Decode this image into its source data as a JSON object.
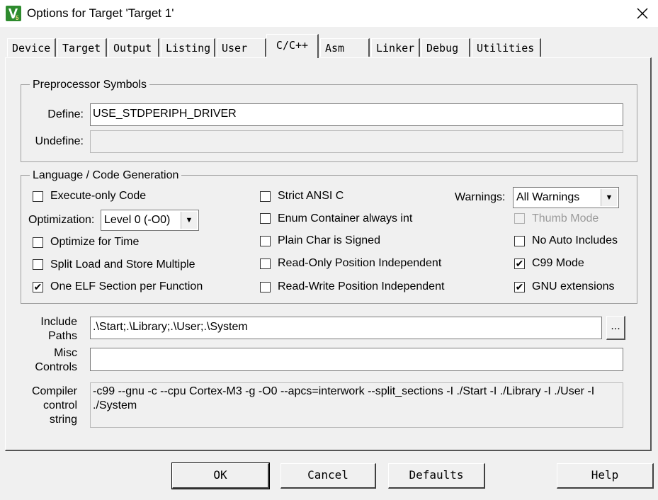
{
  "window": {
    "title": "Options for Target 'Target 1'"
  },
  "tabs": [
    {
      "label": "Device"
    },
    {
      "label": "Target"
    },
    {
      "label": "Output"
    },
    {
      "label": "Listing"
    },
    {
      "label": "User"
    },
    {
      "label": "C/C++"
    },
    {
      "label": "Asm"
    },
    {
      "label": "Linker"
    },
    {
      "label": "Debug"
    },
    {
      "label": "Utilities"
    }
  ],
  "active_tab": "C/C++",
  "preprocessor": {
    "group_label": "Preprocessor Symbols",
    "define_label": "Define:",
    "define_value": "USE_STDPERIPH_DRIVER",
    "undefine_label": "Undefine:",
    "undefine_value": ""
  },
  "codegen": {
    "group_label": "Language / Code Generation",
    "execute_only": {
      "label": "Execute-only Code",
      "checked": false
    },
    "optimization_label": "Optimization:",
    "optimization_value": "Level 0 (-O0)",
    "optimize_time": {
      "label": "Optimize for Time",
      "checked": false
    },
    "split_load": {
      "label": "Split Load and Store Multiple",
      "checked": false
    },
    "one_elf": {
      "label": "One ELF Section per Function",
      "checked": true
    },
    "strict_ansi": {
      "label": "Strict ANSI C",
      "checked": false
    },
    "enum_container": {
      "label": "Enum Container always int",
      "checked": false
    },
    "plain_char": {
      "label": "Plain Char is Signed",
      "checked": false
    },
    "ro_pi": {
      "label": "Read-Only Position Independent",
      "checked": false
    },
    "rw_pi": {
      "label": "Read-Write Position Independent",
      "checked": false
    },
    "warnings_label": "Warnings:",
    "warnings_value": "All Warnings",
    "thumb_mode": {
      "label": "Thumb Mode",
      "checked": false,
      "disabled": true
    },
    "no_auto_includes": {
      "label": "No Auto Includes",
      "checked": false
    },
    "c99_mode": {
      "label": "C99 Mode",
      "checked": true
    },
    "gnu_ext": {
      "label": "GNU extensions",
      "checked": true
    }
  },
  "include_paths": {
    "label_line1": "Include",
    "label_line2": "Paths",
    "value": ".\\Start;.\\Library;.\\User;.\\System",
    "browse_label": "..."
  },
  "misc_controls": {
    "label_line1": "Misc",
    "label_line2": "Controls",
    "value": ""
  },
  "compiler_string": {
    "label_line1": "Compiler",
    "label_line2": "control",
    "label_line3": "string",
    "value": "-c99 --gnu -c --cpu Cortex-M3 -g -O0 --apcs=interwork --split_sections -I ./Start -I ./Library -I ./User -I ./System"
  },
  "buttons": {
    "ok": "OK",
    "cancel": "Cancel",
    "defaults": "Defaults",
    "help": "Help"
  },
  "check_glyph": "✔"
}
